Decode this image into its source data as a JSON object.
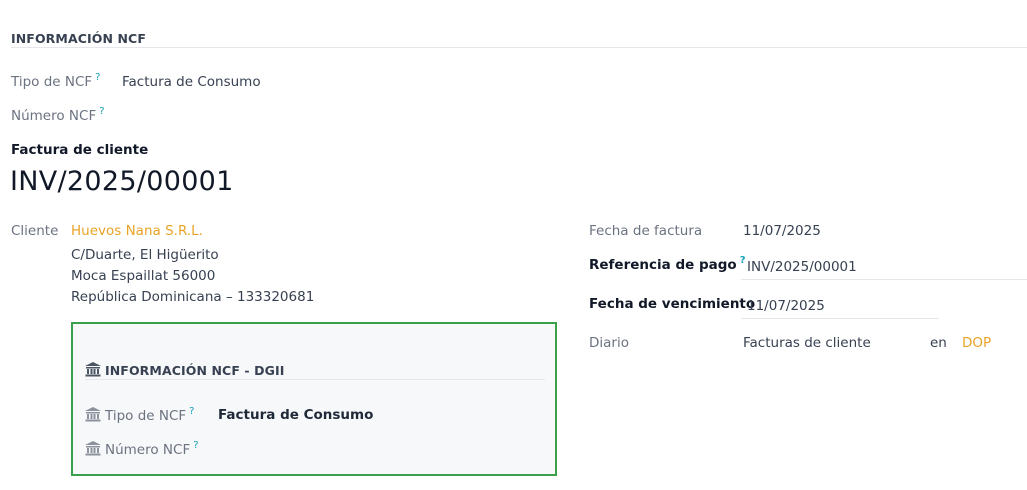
{
  "top_section": {
    "title": "INFORMACIÓN NCF",
    "tipo_label": "Tipo de NCF",
    "tipo_value": "Factura de Consumo",
    "numero_label": "Número NCF",
    "help_mark": "?"
  },
  "invoice": {
    "type_label": "Factura de cliente",
    "number": "INV/2025/00001"
  },
  "customer": {
    "label": "Cliente",
    "name": "Huevos Nana S.R.L.",
    "address_line1": "C/Duarte, El Higüerito",
    "address_line2": "Moca Espaillat 56000",
    "address_line3": "República Dominicana – 133320681"
  },
  "right_fields": {
    "fecha_factura_label": "Fecha de factura",
    "fecha_factura_value": "11/07/2025",
    "referencia_label": "Referencia de pago",
    "referencia_value": "INV/2025/00001",
    "vencimiento_label": "Fecha de vencimiento",
    "vencimiento_value": "11/07/2025",
    "diario_label": "Diario",
    "diario_value": "Facturas de cliente",
    "en_label": "en",
    "currency": "DOP"
  },
  "dgii_box": {
    "title": "INFORMACIÓN NCF - DGII",
    "tipo_label": "Tipo de NCF",
    "tipo_value": "Factura de Consumo",
    "numero_label": "Número NCF",
    "icon": "bank-icon",
    "border_color": "#3aa04a"
  },
  "colors": {
    "accent_orange": "#e9a326",
    "help_teal": "#17a2b8"
  }
}
